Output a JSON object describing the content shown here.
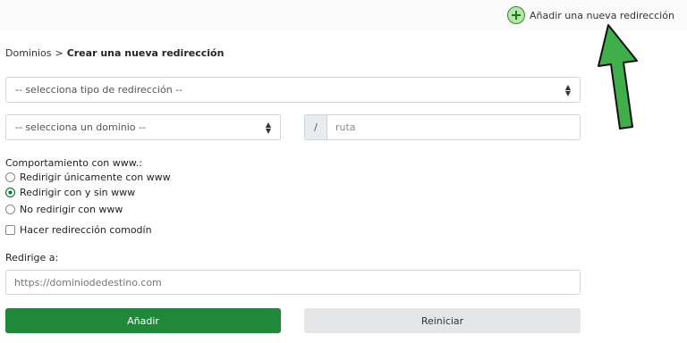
{
  "header": {
    "add_new_label": "Añadir una nueva redirección",
    "add_icon": "plus-circle-icon"
  },
  "breadcrumb": {
    "root": "Dominios",
    "separator": ">",
    "current": "Crear una nueva redirección"
  },
  "form": {
    "redirect_type_select": "-- selecciona tipo de redirección --",
    "domain_select": "-- selecciona un dominio --",
    "path_prefix": "/",
    "path_placeholder": "ruta",
    "www_behavior": {
      "label": "Comportamiento con www.:",
      "options": [
        {
          "label": "Redirigir únicamente con www",
          "checked": false
        },
        {
          "label": "Redirigir con y sin www",
          "checked": true
        },
        {
          "label": "No redirigir con www",
          "checked": false
        }
      ]
    },
    "wildcard_label": "Hacer redirección comodín",
    "wildcard_checked": false,
    "destination_label": "Redirige a:",
    "destination_placeholder": "https://dominiodedestino.com",
    "submit_label": "Añadir",
    "reset_label": "Reiniciar"
  },
  "colors": {
    "primary": "#1f883a",
    "arrow": "#3fae4b",
    "secondary_button": "#e4e6e8"
  }
}
